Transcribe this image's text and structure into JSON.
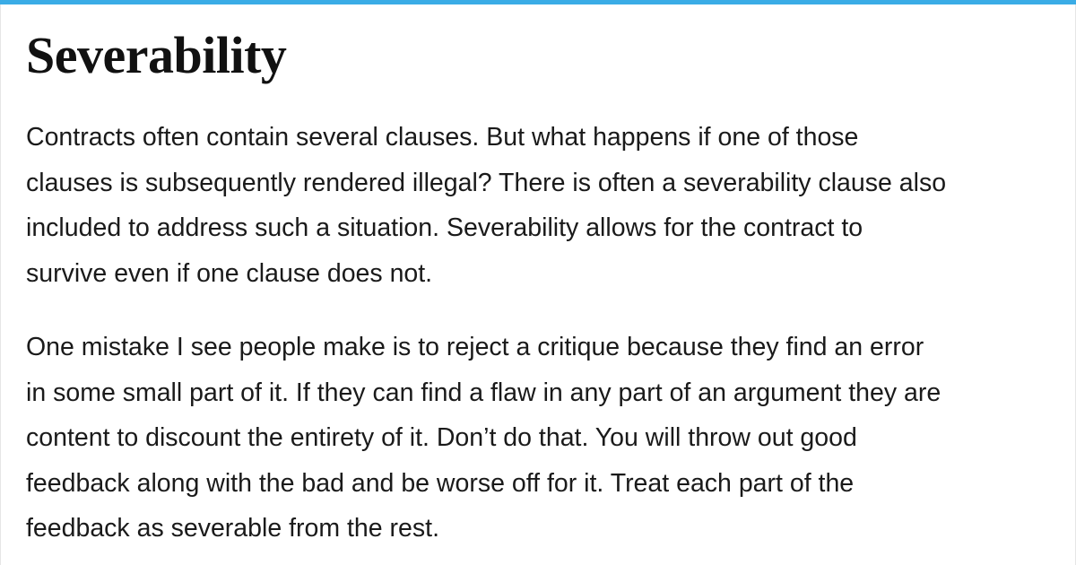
{
  "accent_color": "#3aace6",
  "article": {
    "title": "Severability",
    "paragraphs": [
      "Contracts often contain several clauses. But what happens if one of those\nclauses is subsequently rendered illegal? There is often a severability clause also\nincluded to address such a situation. Severability allows for the contract to\nsurvive even if one clause does not.",
      "One mistake I see people make is to reject a critique because they find an error\nin some small part of it. If they can find a flaw in any part of an argument they are\ncontent to discount the entirety of it. Don’t do that. You will throw out good\nfeedback along with the bad and be worse off for it. Treat each part of the\nfeedback as severable from the rest."
    ]
  }
}
